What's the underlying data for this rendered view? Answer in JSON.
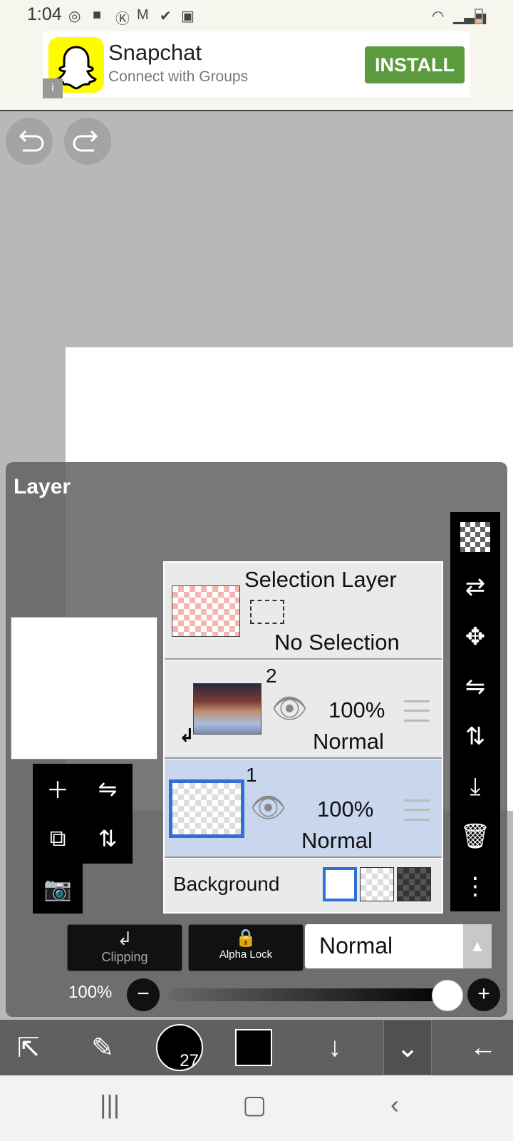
{
  "status_bar": {
    "time": "1:04",
    "left_icons": [
      "sync-icon",
      "chat-icon",
      "k-icon",
      "gmail-icon",
      "check-icon",
      "image-icon"
    ],
    "right_icons": [
      "wifi-icon",
      "signal-icon",
      "battery-icon"
    ]
  },
  "ad": {
    "title": "Snapchat",
    "subtitle": "Connect with Groups",
    "install_label": "INSTALL",
    "info_label": "i",
    "brand_color": "#fffc00",
    "install_color": "#5c9a3e"
  },
  "panel": {
    "title": "Layer"
  },
  "layers": {
    "selection": {
      "name": "Selection Layer",
      "status": "No Selection"
    },
    "layer2": {
      "number": "2",
      "opacity": "100%",
      "blend": "Normal"
    },
    "layer1": {
      "number": "1",
      "opacity": "100%",
      "blend": "Normal",
      "selected": true
    },
    "background": {
      "label": "Background"
    }
  },
  "controls": {
    "clipping_label": "Clipping",
    "alpha_lock_label": "Alpha Lock",
    "blend_mode": "Normal",
    "opacity_label": "100%",
    "opacity_value": 1.0,
    "minus_label": "−",
    "plus_label": "+"
  },
  "toolbar": {
    "brush_size": "27"
  },
  "colors": {
    "selected_layer_bg": "#c9d7ee",
    "selected_border": "#2f6fd6"
  }
}
